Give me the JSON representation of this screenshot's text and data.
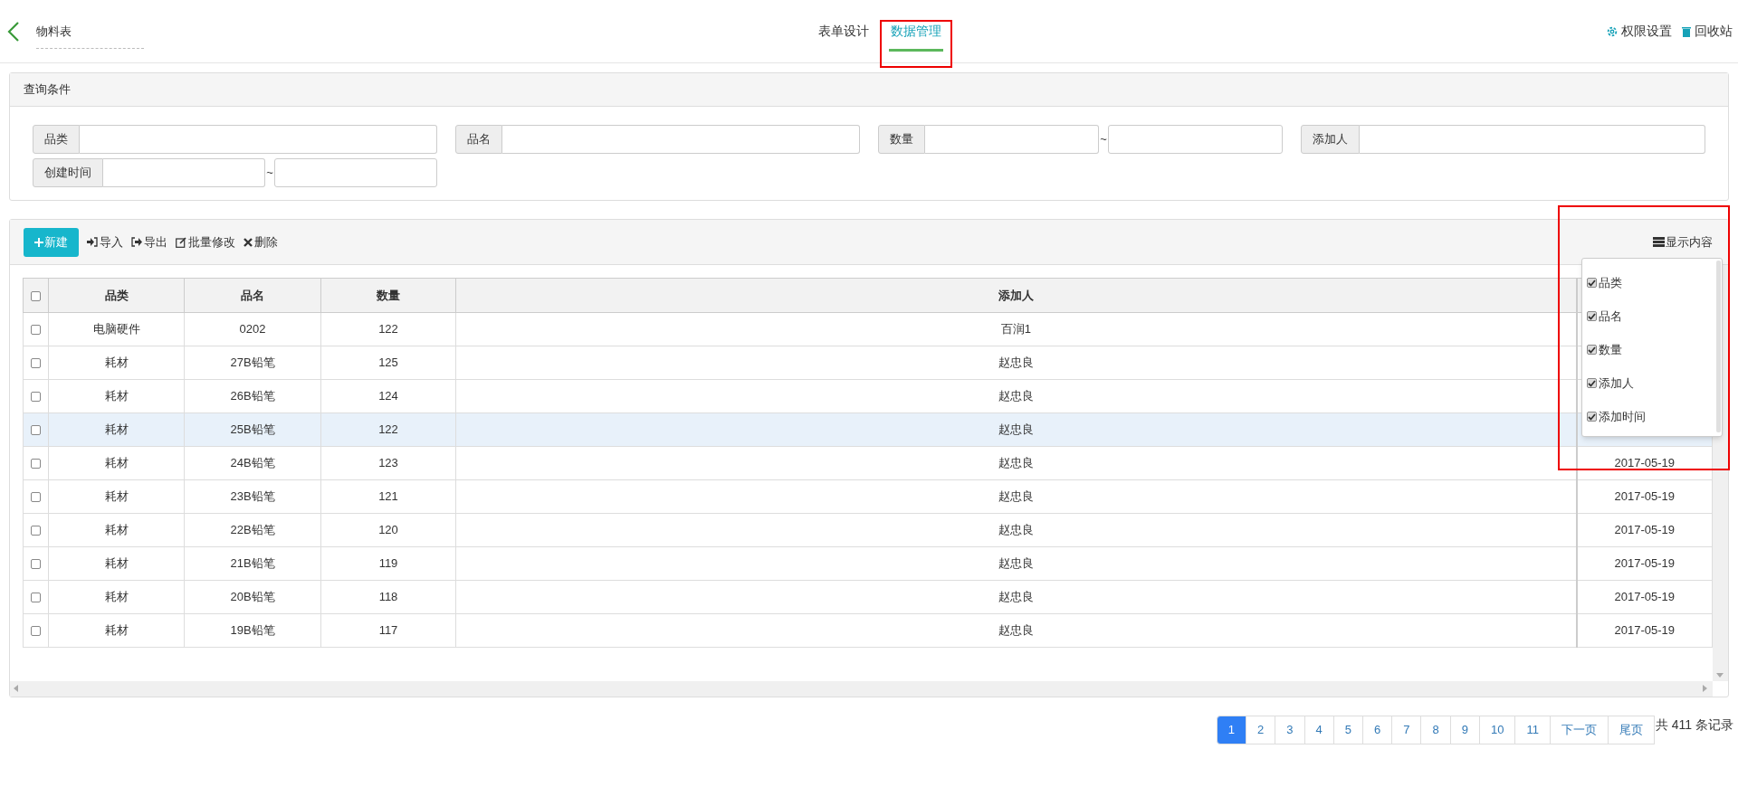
{
  "header": {
    "back_title": "物料表",
    "tabs": [
      {
        "label": "表单设计",
        "selected": false,
        "highlighted": false
      },
      {
        "label": "数据管理",
        "selected": true,
        "highlighted": true
      }
    ],
    "actions": [
      {
        "kind": "settings",
        "label": "权限设置"
      },
      {
        "kind": "trash",
        "label": "回收站"
      }
    ]
  },
  "query": {
    "title": "查询条件",
    "fields": [
      {
        "kind": "single",
        "label": "品类"
      },
      {
        "kind": "single",
        "label": "品名"
      },
      {
        "kind": "range",
        "label": "数量",
        "separator": "~"
      },
      {
        "kind": "single",
        "label": "添加人"
      },
      {
        "kind": "range",
        "label": "创建时间",
        "separator": "~"
      }
    ]
  },
  "toolbar": {
    "buttons": [
      {
        "kind": "new",
        "label": "新建"
      },
      {
        "kind": "import",
        "label": "导入"
      },
      {
        "kind": "export",
        "label": "导出"
      },
      {
        "kind": "edit",
        "label": "批量修改"
      },
      {
        "kind": "delete",
        "label": "删除"
      }
    ],
    "columns_button": "显示内容",
    "columns_highlighted": true
  },
  "columns_menu": [
    {
      "label": "品类",
      "checked": true
    },
    {
      "label": "品名",
      "checked": true
    },
    {
      "label": "数量",
      "checked": true
    },
    {
      "label": "添加人",
      "checked": true
    },
    {
      "label": "添加时间",
      "checked": true
    }
  ],
  "table": {
    "all_checked": false,
    "columns": [
      "品类",
      "品名",
      "数量",
      "添加人"
    ],
    "rows": [
      {
        "checked": false,
        "selected": false,
        "cells": [
          "电脑硬件",
          "0202",
          "122",
          "百润1"
        ]
      },
      {
        "checked": false,
        "selected": false,
        "cells": [
          "耗材",
          "27B铅笔",
          "125",
          "赵忠良"
        ]
      },
      {
        "checked": false,
        "selected": false,
        "cells": [
          "耗材",
          "26B铅笔",
          "124",
          "赵忠良"
        ]
      },
      {
        "checked": false,
        "selected": true,
        "cells": [
          "耗材",
          "25B铅笔",
          "122",
          "赵忠良"
        ]
      },
      {
        "checked": false,
        "selected": false,
        "cells": [
          "耗材",
          "24B铅笔",
          "123",
          "赵忠良"
        ],
        "date": "2017-05-19"
      },
      {
        "checked": false,
        "selected": false,
        "cells": [
          "耗材",
          "23B铅笔",
          "121",
          "赵忠良"
        ],
        "date": "2017-05-19"
      },
      {
        "checked": false,
        "selected": false,
        "cells": [
          "耗材",
          "22B铅笔",
          "120",
          "赵忠良"
        ],
        "date": "2017-05-19"
      },
      {
        "checked": false,
        "selected": false,
        "cells": [
          "耗材",
          "21B铅笔",
          "119",
          "赵忠良"
        ],
        "date": "2017-05-19"
      },
      {
        "checked": false,
        "selected": false,
        "cells": [
          "耗材",
          "20B铅笔",
          "118",
          "赵忠良"
        ],
        "date": "2017-05-19"
      },
      {
        "checked": false,
        "selected": false,
        "cells": [
          "耗材",
          "19B铅笔",
          "117",
          "赵忠良"
        ],
        "date": "2017-05-19"
      }
    ]
  },
  "pagination": {
    "pages": [
      {
        "label": "1",
        "selected": true
      },
      {
        "label": "2",
        "selected": false
      },
      {
        "label": "3",
        "selected": false
      },
      {
        "label": "4",
        "selected": false
      },
      {
        "label": "5",
        "selected": false
      },
      {
        "label": "6",
        "selected": false
      },
      {
        "label": "7",
        "selected": false
      },
      {
        "label": "8",
        "selected": false
      },
      {
        "label": "9",
        "selected": false
      },
      {
        "label": "10",
        "selected": false
      },
      {
        "label": "11",
        "selected": false
      },
      {
        "label": "下一页",
        "selected": false
      },
      {
        "label": "尾页",
        "selected": false
      }
    ],
    "total": "共 411 条记录"
  }
}
